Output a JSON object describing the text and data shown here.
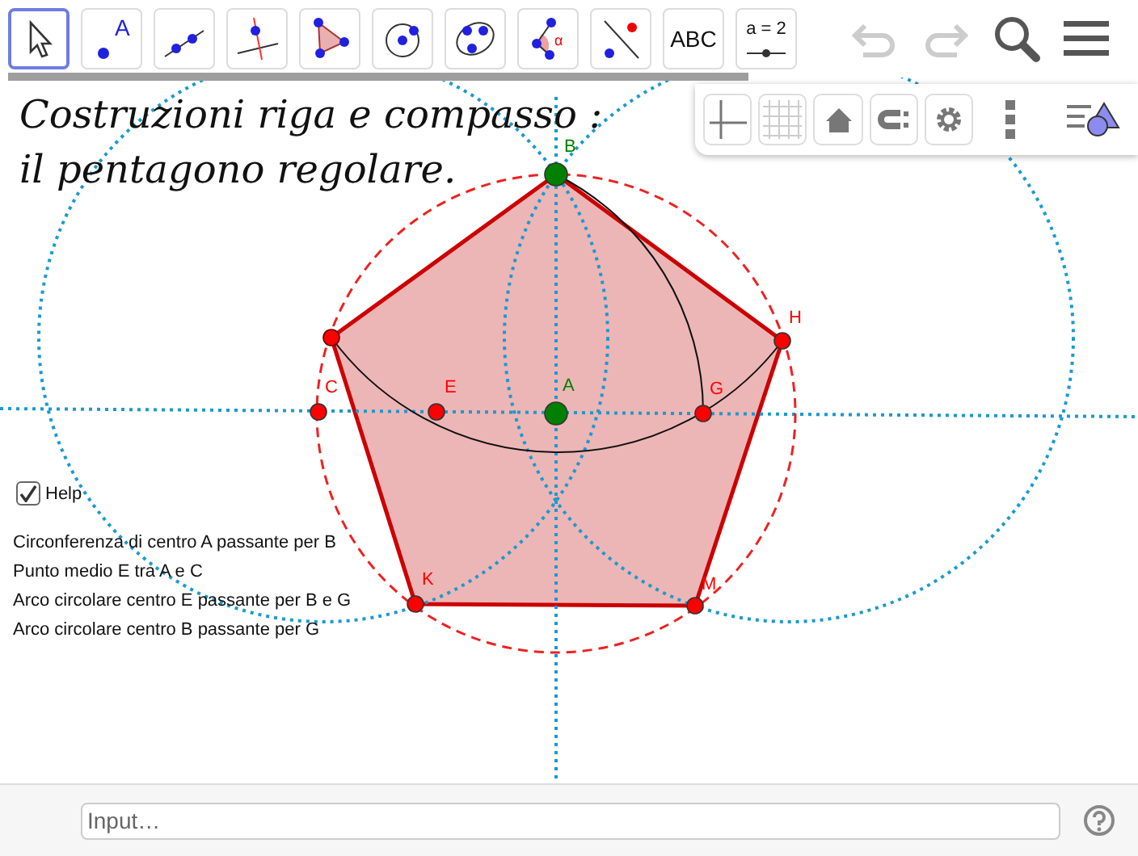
{
  "toolbar": {
    "tools": [
      {
        "kind": "pointer",
        "selected": true
      },
      {
        "kind": "point",
        "selected": false,
        "label": "A"
      },
      {
        "kind": "line",
        "selected": false
      },
      {
        "kind": "perpendicular",
        "selected": false
      },
      {
        "kind": "polygon",
        "selected": false
      },
      {
        "kind": "circle",
        "selected": false
      },
      {
        "kind": "conic",
        "selected": false
      },
      {
        "kind": "angle",
        "selected": false,
        "label": "α"
      },
      {
        "kind": "reflect",
        "selected": false
      },
      {
        "kind": "text",
        "selected": false,
        "label": "ABC"
      },
      {
        "kind": "slider",
        "selected": false,
        "label": "a = 2"
      }
    ]
  },
  "title": [
    "Costruzioni riga e compasso :",
    "il pentagono regolare."
  ],
  "style_bar": {
    "buttons": [
      {
        "kind": "axes"
      },
      {
        "kind": "grid"
      },
      {
        "kind": "home"
      },
      {
        "kind": "magnet"
      },
      {
        "kind": "gear"
      },
      {
        "kind": "more"
      },
      {
        "kind": "views"
      }
    ]
  },
  "help": {
    "label": "Help",
    "checked": true
  },
  "steps": [
    "Circonferenza di centro A passante per B",
    "Punto medio E tra A e C",
    "Arco circolare centro E passante per B e G",
    "Arco circolare centro B passante per G"
  ],
  "points": [
    {
      "label": "B",
      "color": "#008000"
    },
    {
      "label": "H",
      "color": "#ff0000"
    },
    {
      "label": "C",
      "color": "#ff0000"
    },
    {
      "label": "E",
      "color": "#ff0000"
    },
    {
      "label": "A",
      "color": "#008000"
    },
    {
      "label": "G",
      "color": "#ff0000"
    },
    {
      "label": "K",
      "color": "#ff0000"
    },
    {
      "label": "M",
      "color": "#ff0000"
    }
  ],
  "input": {
    "placeholder": "Input…"
  }
}
